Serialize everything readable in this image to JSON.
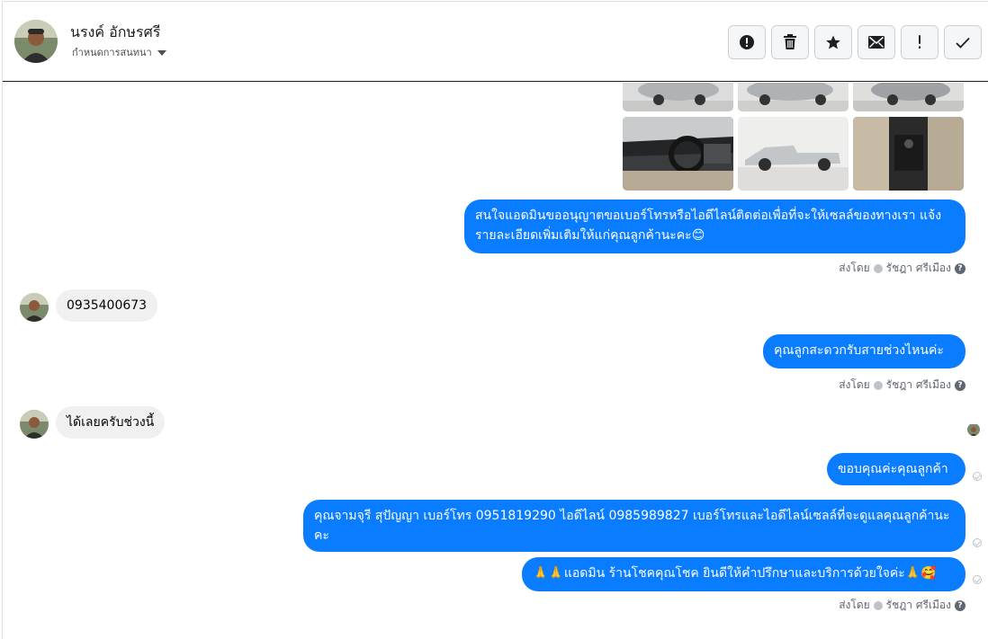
{
  "header": {
    "contact_name": "นรงค์ อักษรศรี",
    "subtitle": "กำหนดการสนทนา",
    "tools": [
      {
        "icon": "alert-circle-icon",
        "label": "!"
      },
      {
        "icon": "trash-icon"
      },
      {
        "icon": "star-icon"
      },
      {
        "icon": "mail-icon"
      },
      {
        "icon": "exclamation-icon",
        "label": "!"
      },
      {
        "icon": "check-icon"
      }
    ]
  },
  "messages": {
    "m1": "สนใจแอดมินขออนุญาตขอเบอร์โทรหรือไอดีไลน์ติดต่อเพื่อที่จะให้เซลล์ของทางเรา แจ้งรายละเอียดเพิ่มเติมให้แก่คุณลูกค้านะคะ😊",
    "m2": "0935400673",
    "m3": "คุณลูกสะดวกรับสายช่วงไหนค่ะ",
    "m4": "ได้เลยครับช่วงนี้",
    "m5": "ขอบคุณค่ะคุณลูกค้า",
    "m6": "คุณจามจุรี สุปัญญา เบอร์โทร 0951819290  ไอดีไลน์ 0985989827   เบอร์โทรและไอดีไลน์เซลล์ที่จะดูแลคุณลูกค้านะคะ",
    "m7": "🙏🙏แอดมิน ร้านโชคคุณโชค ยินดีให้คำปรึกษาและบริการด้วยใจค่ะ🙏🥰"
  },
  "sent_by": {
    "prefix": "ส่งโดย",
    "agent": "รัชฎา ศรีเมือง"
  },
  "colors": {
    "outgoing": "#0a7cff",
    "incoming": "#f0f0f0"
  }
}
